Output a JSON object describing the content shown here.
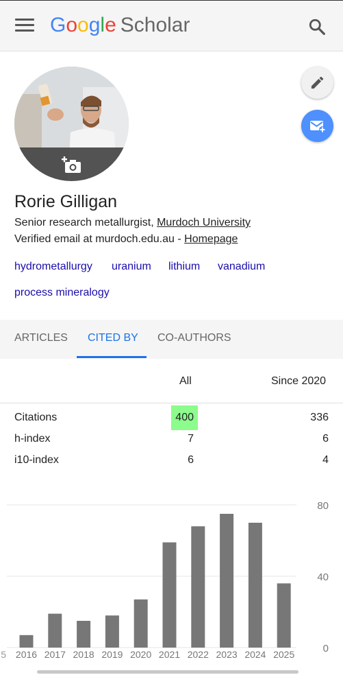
{
  "header": {
    "logo_letters": [
      "G",
      "o",
      "o",
      "g",
      "l",
      "e"
    ],
    "logo_scholar": "Scholar",
    "menu_icon": "menu-icon",
    "search_icon": "search-icon"
  },
  "profile": {
    "name": "Rorie Gilligan",
    "title_prefix": "Senior research metallurgist, ",
    "institution": "Murdoch University",
    "email_text": "Verified email at murdoch.edu.au - ",
    "homepage": "Homepage",
    "interests": [
      "hydrometallurgy",
      "uranium",
      "lithium",
      "vanadium",
      "process mineralogy"
    ]
  },
  "actions": {
    "edit_icon": "pencil-icon",
    "follow_icon": "mail-plus-icon",
    "photo_icon": "add-photo-icon"
  },
  "tabs": [
    {
      "label": "ARTICLES",
      "active": false
    },
    {
      "label": "CITED BY",
      "active": true
    },
    {
      "label": "CO-AUTHORS",
      "active": false
    }
  ],
  "citations": {
    "col_all": "All",
    "col_since": "Since 2020",
    "rows": [
      {
        "label": "Citations",
        "all": "400",
        "since": "336"
      },
      {
        "label": "h-index",
        "all": "7",
        "since": "6"
      },
      {
        "label": "i10-index",
        "all": "6",
        "since": "4"
      }
    ],
    "highlight_color": "#8cfc8c"
  },
  "chart_data": {
    "type": "bar",
    "categories": [
      "2016",
      "2017",
      "2018",
      "2019",
      "2020",
      "2021",
      "2022",
      "2023",
      "2024",
      "2025"
    ],
    "values": [
      7,
      19,
      15,
      18,
      27,
      59,
      68,
      75,
      70,
      36
    ],
    "partial_left_label": "5",
    "yticks": [
      0,
      40,
      80
    ],
    "ylim": [
      0,
      80
    ],
    "bar_color": "#777777",
    "grid": true
  },
  "colors": {
    "accent": "#1a73e8",
    "link": "#1a0dab",
    "fab": "#4d90fe"
  }
}
